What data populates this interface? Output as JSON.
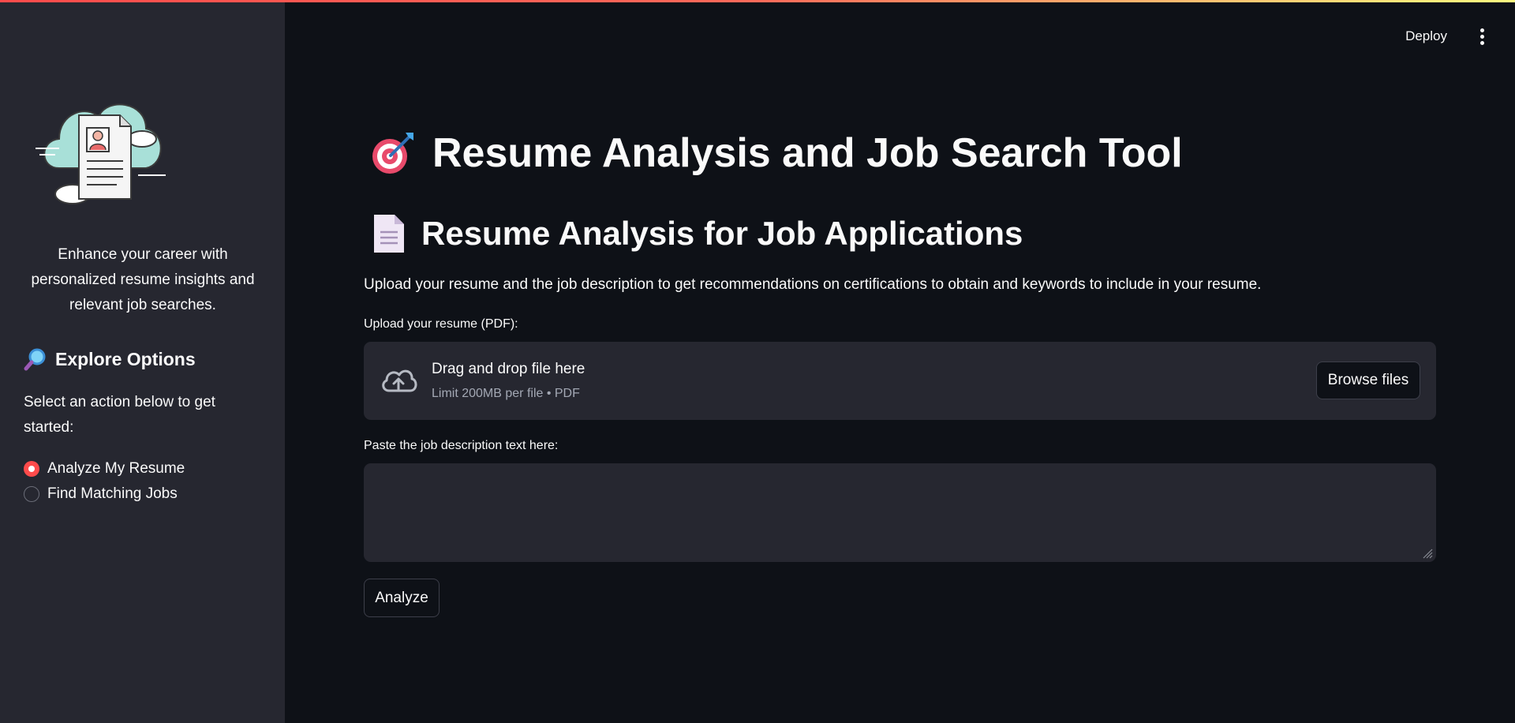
{
  "header": {
    "deploy_label": "Deploy"
  },
  "sidebar": {
    "tagline": "Enhance your career with personalized resume insights and relevant job searches.",
    "explore_heading": "Explore Options",
    "select_text": "Select an action below to get started:",
    "options": [
      {
        "label": "Analyze My Resume",
        "selected": true
      },
      {
        "label": "Find Matching Jobs",
        "selected": false
      }
    ]
  },
  "main": {
    "title": "Resume Analysis and Job Search Tool",
    "subtitle": "Resume Analysis for Job Applications",
    "description": "Upload your resume and the job description to get recommendations on certifications to obtain and keywords to include in your resume.",
    "upload": {
      "label": "Upload your resume (PDF):",
      "drag_text": "Drag and drop file here",
      "limit_text": "Limit 200MB per file • PDF",
      "browse_label": "Browse files"
    },
    "job_description": {
      "label": "Paste the job description text here:",
      "value": "",
      "placeholder": ""
    },
    "analyze_label": "Analyze"
  },
  "colors": {
    "background": "#0e1117",
    "sidebar": "#262730",
    "accent": "#ff4b4b",
    "text": "#fafafa"
  }
}
